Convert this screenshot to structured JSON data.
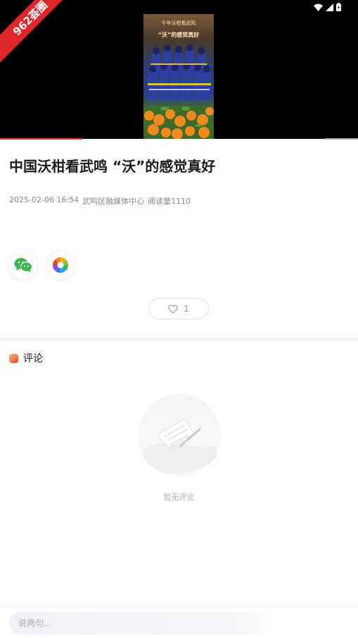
{
  "ribbon": {
    "text": "962荟圈"
  },
  "video": {
    "thumb_caption_top": "千年沃柑看武鸣",
    "thumb_caption_main": "“沃”的感觉真好",
    "progress_fraction": 0.23
  },
  "article": {
    "title": "中国沃柑看武鸣 “沃”的感觉真好",
    "date": "2025-02-06 16:54",
    "source": "武鸣区融媒体中心",
    "reads": "阅读量1110"
  },
  "share": {
    "wechat_icon": "wechat-icon",
    "moments_icon": "moments-icon"
  },
  "like": {
    "count": "1",
    "icon": "heart-outline-icon"
  },
  "comments": {
    "title": "评论",
    "empty_text": "暂无评论",
    "input_placeholder": "说两句..."
  },
  "colors": {
    "accent": "#e0262b",
    "progress": "#e53935"
  }
}
